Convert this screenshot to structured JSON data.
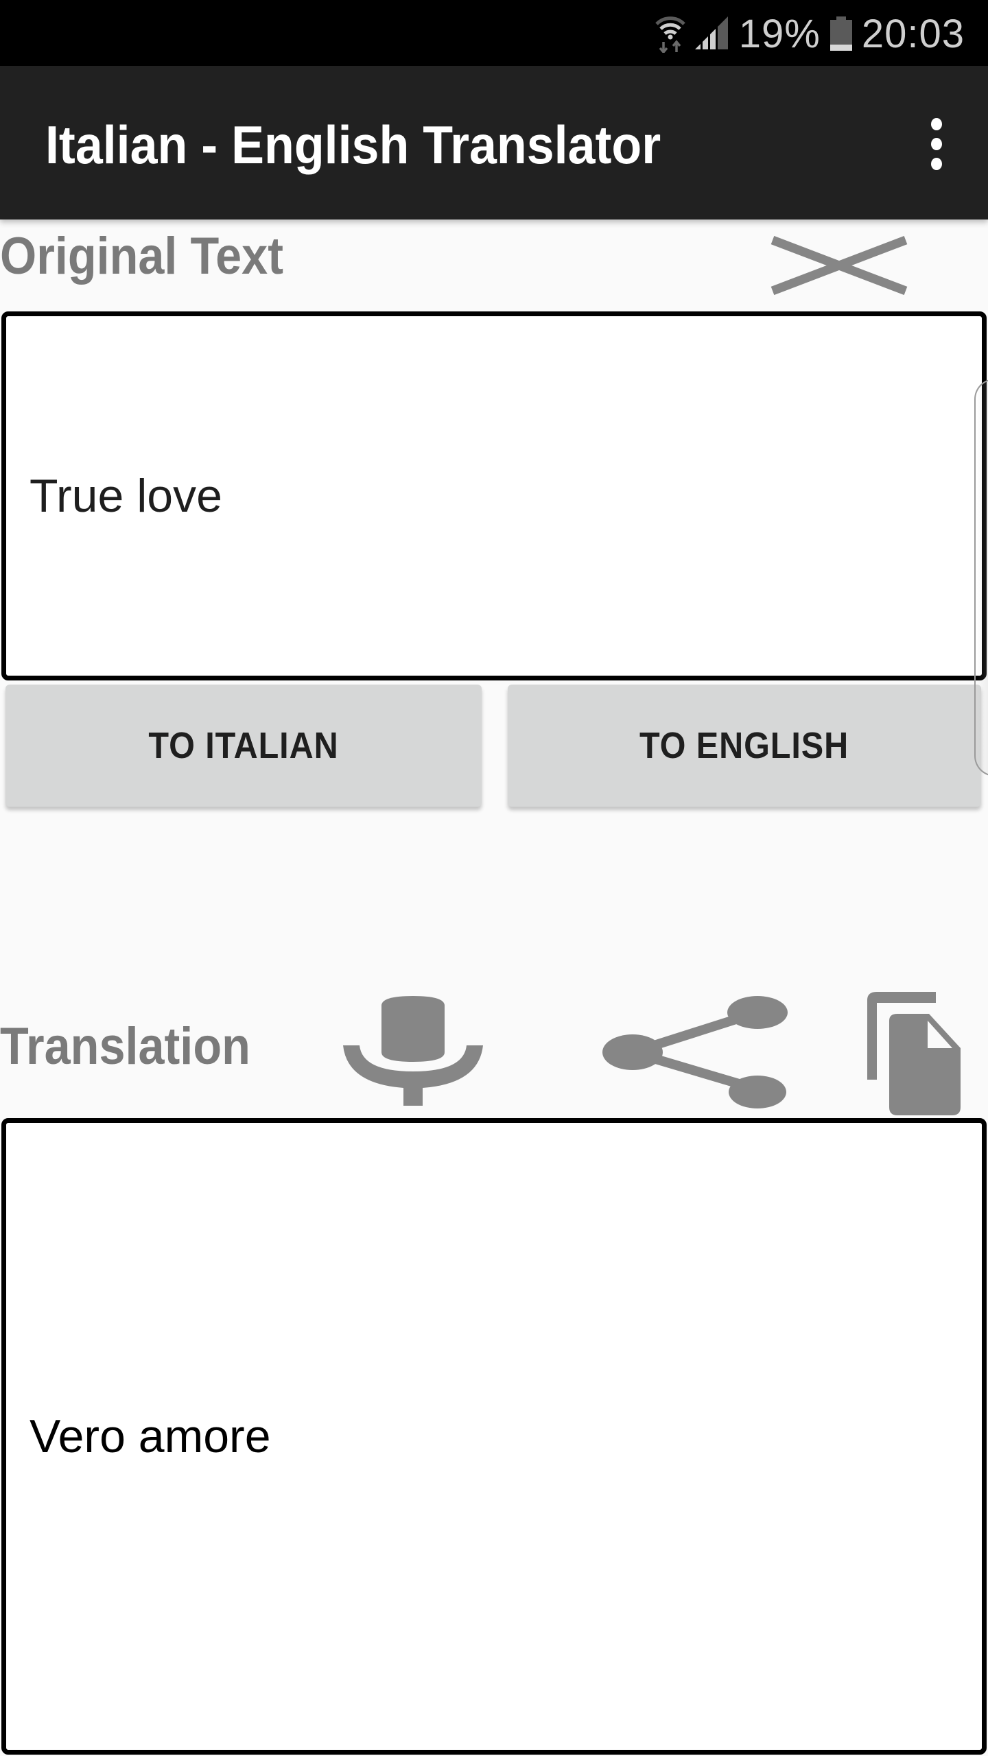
{
  "status_bar": {
    "wifi_icon": "wifi-icon",
    "signal_icon": "cell-signal-icon",
    "battery_percent": "19%",
    "battery_icon": "battery-icon",
    "battery_level": 0.19,
    "time": "20:03"
  },
  "app_bar": {
    "title": "Italian - English Translator",
    "overflow_icon": "more-vertical-icon"
  },
  "original": {
    "label": "Original Text",
    "clear_icon": "close-icon",
    "value": "True love"
  },
  "actions": {
    "to_italian": "TO ITALIAN",
    "to_english": "TO ENGLISH"
  },
  "translation": {
    "label": "Translation",
    "mic_icon": "microphone-icon",
    "share_icon": "share-icon",
    "copy_icon": "copy-icon",
    "value": "Vero amore"
  },
  "colors": {
    "app_bar": "#212121",
    "status_bar": "#000000",
    "label_gray": "#7a7a7a",
    "icon_gray": "#868686",
    "button_bg": "#d6d7d7",
    "background": "#fafafa"
  }
}
